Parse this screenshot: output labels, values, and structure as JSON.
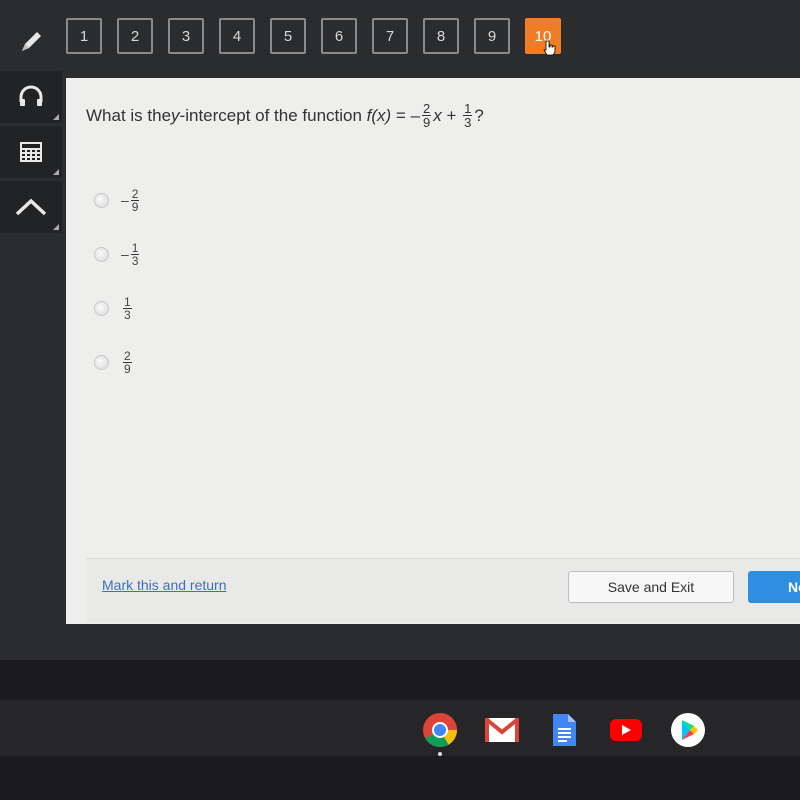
{
  "question_nav": {
    "items": [
      "1",
      "2",
      "3",
      "4",
      "5",
      "6",
      "7",
      "8",
      "9",
      "10"
    ],
    "active_index": 9,
    "active_color": "#f07d25"
  },
  "toolbar": {
    "tools": [
      {
        "name": "pencil-icon",
        "label": "Pencil"
      },
      {
        "name": "headphones-icon",
        "label": "Audio"
      },
      {
        "name": "calculator-icon",
        "label": "Calculator"
      },
      {
        "name": "arrow-up-icon",
        "label": "Collapse"
      }
    ]
  },
  "question": {
    "prefix": "What is the ",
    "italic_term": "y",
    "middle": "-intercept of the function ",
    "function_name": "f(x)",
    "equals": " = –",
    "frac1_num": "2",
    "frac1_den": "9",
    "var": "x",
    "plus": " + ",
    "frac2_num": "1",
    "frac2_den": "3",
    "suffix": "?"
  },
  "options": [
    {
      "sign": "–",
      "num": "2",
      "den": "9"
    },
    {
      "sign": "–",
      "num": "1",
      "den": "3"
    },
    {
      "sign": "",
      "num": "1",
      "den": "3"
    },
    {
      "sign": "",
      "num": "2",
      "den": "9"
    }
  ],
  "footer": {
    "mark_link": "Mark this and return",
    "save_exit": "Save and Exit",
    "next": "Next"
  },
  "shelf": {
    "apps": [
      "chrome-icon",
      "gmail-icon",
      "docs-icon",
      "youtube-icon",
      "play-store-icon"
    ]
  }
}
